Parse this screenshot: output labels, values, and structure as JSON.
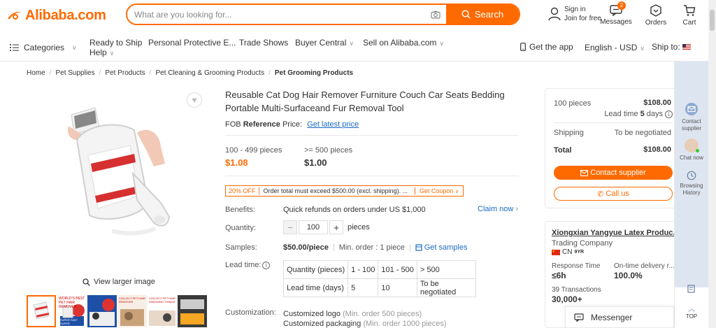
{
  "header": {
    "logo": "Alibaba.com",
    "search_placeholder": "What are you looking for...",
    "search_button": "Search",
    "sign_in": "Sign in",
    "join": "Join for free",
    "messages": "Messages",
    "messages_count": "2",
    "orders": "Orders",
    "cart": "Cart"
  },
  "nav": {
    "categories": "Categories",
    "ready_to_ship": "Ready to Ship",
    "help": "Help",
    "ppe": "Personal Protective E...",
    "trade_shows": "Trade Shows",
    "buyer_central": "Buyer Central",
    "sell": "Sell on Alibaba.com",
    "get_app": "Get the app",
    "language": "English - USD",
    "ship_to": "Ship to:"
  },
  "breadcrumb": [
    "Home",
    "Pet Supplies",
    "Pet Products",
    "Pet Cleaning & Grooming Products",
    "Pet Grooming Products"
  ],
  "gallery": {
    "view_larger": "View larger image",
    "thumb_texts": [
      "WORLD'S BEST PET HAIR REMOVER",
      "SUPER FAST SUPER EFFECTIVE",
      "COLLECT PET HAIR REMOVER",
      "COLLECT PET HAIR SHEDDING THINGS",
      "",
      ""
    ]
  },
  "product": {
    "title": "Reusable Cat Dog Hair Remover Furniture Couch Car Seats Bedding Portable Multi-Surfaceand Fur Removal Tool",
    "fob_prefix": "FOB",
    "fob_reference": "Reference",
    "fob_price": "Price:",
    "fob_link": "Get latest price",
    "tiers": [
      {
        "qty": "100 - 499 pieces",
        "price": "$1.08"
      },
      {
        "qty": ">= 500 pieces",
        "price": "$1.00"
      }
    ],
    "coupon_off": "20% OFF",
    "coupon_text": "Order total must exceed $500.00 (excl. shipping). ...",
    "coupon_get": "Get Coupon",
    "benefits_label": "Benefits:",
    "benefits_value": "Quick refunds on orders under US $1,000",
    "claim": "Claim now",
    "quantity_label": "Quantity:",
    "quantity_value": "100",
    "quantity_unit": "pieces",
    "samples_label": "Samples:",
    "samples_price": "$50.00/piece",
    "samples_min": "Min. order : 1 piece",
    "get_samples": "Get samples",
    "leadtime_label": "Lead time:",
    "leadtime_table": [
      [
        "Quantity (pieces)",
        "1 - 100",
        "101 - 500",
        "> 500"
      ],
      [
        "Lead time (days)",
        "5",
        "10",
        "To be negotiated"
      ]
    ],
    "customization_label": "Customization:",
    "custom_logo": "Customized logo",
    "custom_logo_min": "(Min. order 500 pieces)",
    "custom_pack": "Customized packaging",
    "custom_pack_min": "(Min. order 1000 pieces)"
  },
  "order_card": {
    "qty": "100 pieces",
    "amount": "$108.00",
    "lead_prefix": "Lead time",
    "lead_days": "5",
    "lead_suffix": "days",
    "shipping_label": "Shipping",
    "shipping_value": "To be negotiated",
    "total_label": "Total",
    "total_value": "$108.00",
    "contact_btn": "Contact supplier",
    "call_btn": "Call us"
  },
  "supplier": {
    "name": "Xiongxian Yangyue Latex Produc...",
    "type": "Trading Company",
    "country": "CN",
    "years": "9YR",
    "resp_label": "Response Time",
    "resp_value": "≤6h",
    "ontime_label": "On-time delivery r...",
    "ontime_value": "100.0%",
    "tx_label": "39 Transactions",
    "tx_value": "30,000+"
  },
  "sidebar": {
    "contact": "Contact supplier",
    "chat": "Chat now",
    "history": "Browsing History",
    "top": "TOP"
  },
  "messenger": "Messenger",
  "colors": {
    "accent": "#ff6a00",
    "link": "#1a6bc1",
    "sidebar_bg": "#dde5f1"
  }
}
